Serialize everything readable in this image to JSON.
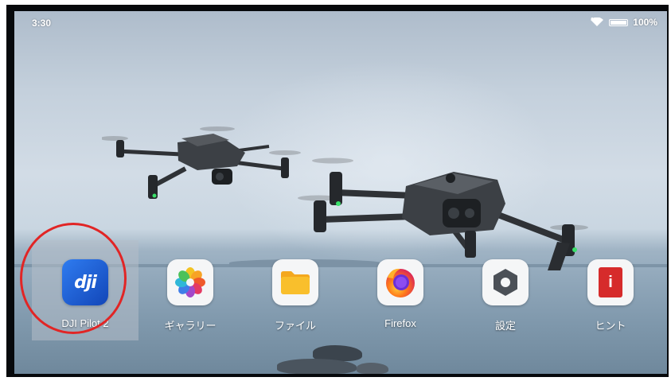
{
  "status_bar": {
    "time": "3:30",
    "battery": "100%",
    "battery_level": 1.0,
    "icons": [
      "wifi-icon",
      "battery-icon"
    ]
  },
  "wallpaper": {
    "subject": "drones over sea"
  },
  "apps": [
    {
      "label": "DJI Pilot 2",
      "icon": "dji-icon",
      "color": "#1e5fd6",
      "selected": true
    },
    {
      "label": "ギャラリー",
      "icon": "gallery-flower-icon",
      "color": "#f5f6f7",
      "selected": false
    },
    {
      "label": "ファイル",
      "icon": "folder-icon",
      "color": "#f5f6f7",
      "selected": false
    },
    {
      "label": "Firefox",
      "icon": "firefox-icon",
      "color": "#f5f6f7",
      "selected": false
    },
    {
      "label": "設定",
      "icon": "settings-hexagon-icon",
      "color": "#f5f6f7",
      "selected": false
    },
    {
      "label": "ヒント",
      "icon": "tips-icon",
      "color": "#d62b2b",
      "selected": false
    }
  ],
  "dji_logo_text": "dji",
  "tips_glyph": "i",
  "highlight_color": "#e12525"
}
